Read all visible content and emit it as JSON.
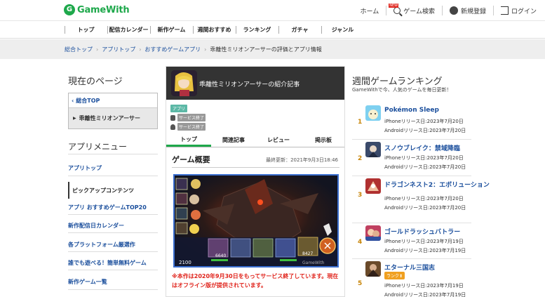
{
  "header": {
    "logo_mark": "G",
    "logo_text": "GameWith",
    "nav": [
      {
        "label": "ホーム"
      },
      {
        "label": "ゲーム検索",
        "badge": "NEW"
      },
      {
        "label": "新規登録"
      },
      {
        "label": "ログイン"
      }
    ]
  },
  "mainnav": [
    "トップ",
    "配信カレンダー",
    "新作ゲーム",
    "週間おすすめ",
    "ランキング",
    "ガチャ",
    "ジャンル"
  ],
  "breadcrumb": {
    "items": [
      "総合トップ",
      "アプリトップ",
      "おすすめゲームアプリ"
    ],
    "current": "乖離性ミリオンアーサーの評価とアプリ情報",
    "separator": "›"
  },
  "left": {
    "current_page_title": "現在のページ",
    "back_link": "総合TOP",
    "current_item": "乖離性ミリオンアーサー",
    "app_menu_title": "アプリメニュー",
    "app_top": "アプリトップ",
    "pickup_title": "ピックアップコンテンツ",
    "links": [
      "アプリ おすすめゲームTOP20",
      "新作配信日カレンダー",
      "各プラットフォーム厳選作",
      "誰でも遊べる！簡単無料ゲーム",
      "新作ゲーム一覧"
    ]
  },
  "center": {
    "app_title": "乖離性ミリオンアーサーの紹介記事",
    "tag": "アプリ",
    "platforms": [
      {
        "os": "ios",
        "status": "サービス終了"
      },
      {
        "os": "android",
        "status": "サービス終了"
      }
    ],
    "tabs": [
      "トップ",
      "関連記事",
      "レビュー",
      "掲示板"
    ],
    "overview_title": "ゲーム概要",
    "updated": "最終更新：2021年9月3日18:46",
    "screenshot": {
      "watermark": "GameWith",
      "hp_values": [
        "6640",
        "8427"
      ],
      "counter": "2100"
    },
    "notice": "※本作は2020年9月30日をもってサービス終了しています。現在はオフライン版が提供されています。"
  },
  "right": {
    "title": "週間ゲームランキング",
    "subtitle": "GameWithで今、人気のゲームを毎日更新！",
    "ranks": [
      {
        "num": "1",
        "name": "Pokémon Sleep",
        "iphone": "iPhoneリリース日:2023年7月20日",
        "android": "Androidリリース日:2023年7月20日",
        "icon_color": "#7ed0f0"
      },
      {
        "num": "2",
        "name": "スノウブレイク：禁域降臨",
        "iphone": "iPhoneリリース日:2023年7月20日",
        "android": "Androidリリース日:2023年7月20日",
        "icon_color": "#3a4a6a"
      },
      {
        "num": "3",
        "name": "ドラゴンネスト2：エボリューション",
        "iphone": "iPhoneリリース日:2023年7月20日",
        "android": "Androidリリース日:2023年7月20日",
        "icon_color": "#b03030"
      },
      {
        "num": "4",
        "name": "ゴールドラッシュバトラー",
        "iphone": "iPhoneリリース日:2023年7月19日",
        "android": "Androidリリース日:2023年7月19日",
        "icon_color": "#c04060"
      },
      {
        "num": "5",
        "name": "エターナル三国志",
        "badge": "ランク⬆",
        "iphone": "iPhoneリリース日:2023年7月19日",
        "android": "Androidリリース日:2023年7月19日",
        "icon_color": "#6a4a2a"
      }
    ]
  }
}
